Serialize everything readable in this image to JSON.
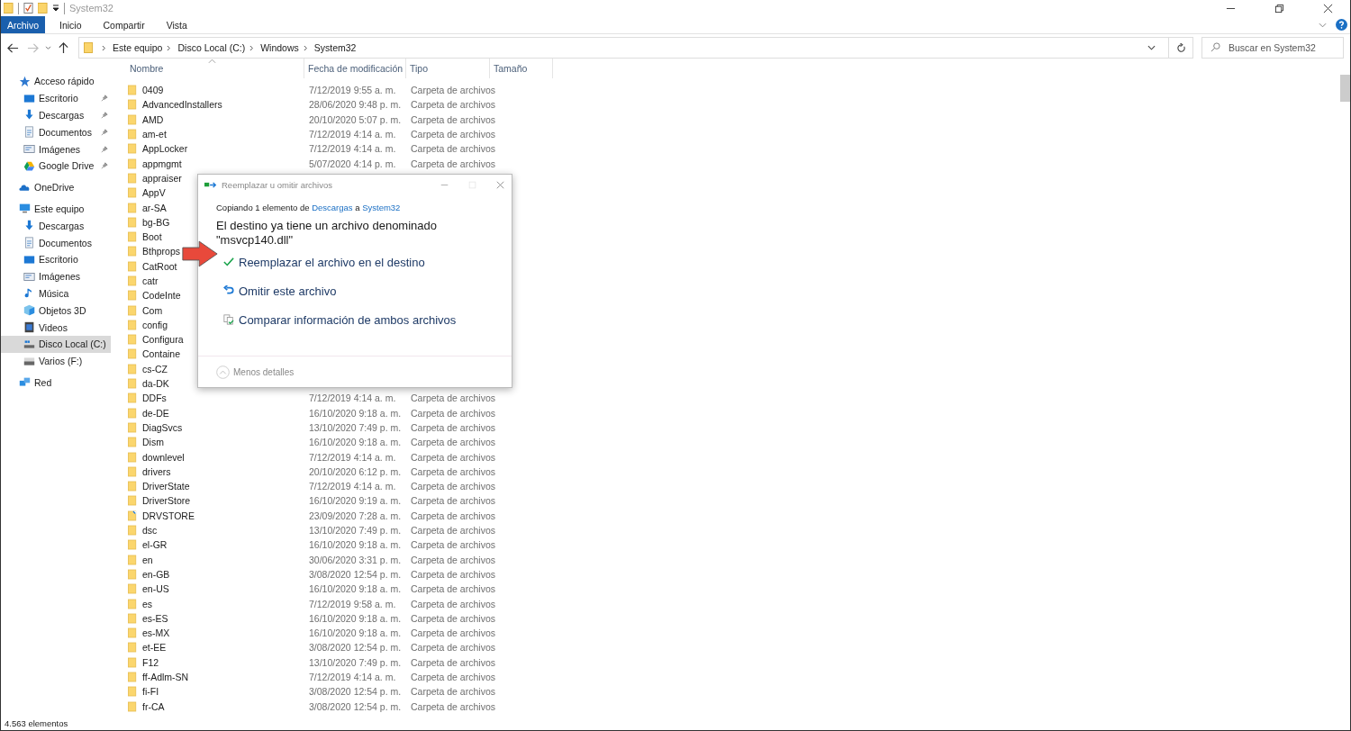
{
  "window": {
    "title": "System32"
  },
  "ribbon_tabs": [
    {
      "label": "Archivo",
      "selected": true
    },
    {
      "label": "Inicio",
      "selected": false
    },
    {
      "label": "Compartir",
      "selected": false
    },
    {
      "label": "Vista",
      "selected": false
    }
  ],
  "address": {
    "crumbs": [
      "Este equipo",
      "Disco Local (C:)",
      "Windows",
      "System32"
    ]
  },
  "search": {
    "placeholder": "Buscar en System32"
  },
  "sidebar": {
    "sections": [
      {
        "label": "Acceso rápido",
        "kind": "star",
        "selected": false,
        "children": [
          {
            "label": "Escritorio",
            "kind": "desktop",
            "pinned": true,
            "selected": false
          },
          {
            "label": "Descargas",
            "kind": "download",
            "pinned": true,
            "selected": false
          },
          {
            "label": "Documentos",
            "kind": "document",
            "pinned": true,
            "selected": false
          },
          {
            "label": "Imágenes",
            "kind": "pictures",
            "pinned": true,
            "selected": false
          },
          {
            "label": "Google Drive",
            "kind": "drive",
            "pinned": true,
            "selected": false
          }
        ]
      },
      {
        "label": "OneDrive",
        "kind": "cloud",
        "selected": false
      },
      {
        "label": "Este equipo",
        "kind": "computer",
        "selected": false,
        "children": [
          {
            "label": "Descargas",
            "kind": "download",
            "pinned": false,
            "selected": false
          },
          {
            "label": "Documentos",
            "kind": "document",
            "pinned": false,
            "selected": false
          },
          {
            "label": "Escritorio",
            "kind": "desktop",
            "pinned": false,
            "selected": false
          },
          {
            "label": "Imágenes",
            "kind": "pictures",
            "pinned": false,
            "selected": false
          },
          {
            "label": "Música",
            "kind": "music",
            "pinned": false,
            "selected": false
          },
          {
            "label": "Objetos 3D",
            "kind": "cube",
            "pinned": false,
            "selected": false
          },
          {
            "label": "Videos",
            "kind": "film",
            "pinned": false,
            "selected": false
          },
          {
            "label": "Disco Local (C:)",
            "kind": "disk",
            "pinned": false,
            "selected": true
          },
          {
            "label": "Varios (F:)",
            "kind": "removable",
            "pinned": false,
            "selected": false
          }
        ]
      },
      {
        "label": "Red",
        "kind": "network",
        "selected": false
      }
    ]
  },
  "table": {
    "columns": [
      "Nombre",
      "Fecha de modificación",
      "Tipo",
      "Tamaño"
    ],
    "rows": [
      {
        "name": "0409",
        "kind": "folder",
        "date": "7/12/2019 9:55 a. m.",
        "type": "Carpeta de archivos"
      },
      {
        "name": "AdvancedInstallers",
        "kind": "folder",
        "date": "28/06/2020 9:48 p. m.",
        "type": "Carpeta de archivos"
      },
      {
        "name": "AMD",
        "kind": "folder",
        "date": "20/10/2020 5:07 p. m.",
        "type": "Carpeta de archivos"
      },
      {
        "name": "am-et",
        "kind": "folder",
        "date": "7/12/2019 4:14 a. m.",
        "type": "Carpeta de archivos"
      },
      {
        "name": "AppLocker",
        "kind": "folder",
        "date": "7/12/2019 4:14 a. m.",
        "type": "Carpeta de archivos"
      },
      {
        "name": "appmgmt",
        "kind": "folder",
        "date": "5/07/2020 4:14 p. m.",
        "type": "Carpeta de archivos"
      },
      {
        "name": "appraiser",
        "kind": "folder"
      },
      {
        "name": "AppV",
        "kind": "folder"
      },
      {
        "name": "ar-SA",
        "kind": "folder"
      },
      {
        "name": "bg-BG",
        "kind": "folder"
      },
      {
        "name": "Boot",
        "kind": "folder"
      },
      {
        "name": "Bthprops",
        "kind": "folder"
      },
      {
        "name": "CatRoot",
        "kind": "folder"
      },
      {
        "name": "catr",
        "kind": "folder"
      },
      {
        "name": "CodeInte",
        "kind": "folder"
      },
      {
        "name": "Com",
        "kind": "folder"
      },
      {
        "name": "config",
        "kind": "folder"
      },
      {
        "name": "Configura",
        "kind": "folder"
      },
      {
        "name": "Containe",
        "kind": "folder"
      },
      {
        "name": "cs-CZ",
        "kind": "folder"
      },
      {
        "name": "da-DK",
        "kind": "folder"
      },
      {
        "name": "DDFs",
        "kind": "folder",
        "date": "7/12/2019 4:14 a. m.",
        "type": "Carpeta de archivos"
      },
      {
        "name": "de-DE",
        "kind": "folder",
        "date": "16/10/2020 9:18 a. m.",
        "type": "Carpeta de archivos"
      },
      {
        "name": "DiagSvcs",
        "kind": "folder",
        "date": "13/10/2020 7:49 p. m.",
        "type": "Carpeta de archivos"
      },
      {
        "name": "Dism",
        "kind": "folder",
        "date": "16/10/2020 9:18 a. m.",
        "type": "Carpeta de archivos"
      },
      {
        "name": "downlevel",
        "kind": "folder",
        "date": "7/12/2019 4:14 a. m.",
        "type": "Carpeta de archivos"
      },
      {
        "name": "drivers",
        "kind": "folder",
        "date": "20/10/2020 6:12 p. m.",
        "type": "Carpeta de archivos"
      },
      {
        "name": "DriverState",
        "kind": "folder",
        "date": "7/12/2019 4:14 a. m.",
        "type": "Carpeta de archivos"
      },
      {
        "name": "DriverStore",
        "kind": "folder",
        "date": "16/10/2020 9:19 a. m.",
        "type": "Carpeta de archivos"
      },
      {
        "name": "DRVSTORE",
        "kind": "link",
        "date": "23/09/2020 7:28 a. m.",
        "type": "Carpeta de archivos"
      },
      {
        "name": "dsc",
        "kind": "folder",
        "date": "13/10/2020 7:49 p. m.",
        "type": "Carpeta de archivos"
      },
      {
        "name": "el-GR",
        "kind": "folder",
        "date": "16/10/2020 9:18 a. m.",
        "type": "Carpeta de archivos"
      },
      {
        "name": "en",
        "kind": "folder",
        "date": "30/06/2020 3:31 p. m.",
        "type": "Carpeta de archivos"
      },
      {
        "name": "en-GB",
        "kind": "folder",
        "date": "3/08/2020 12:54 p. m.",
        "type": "Carpeta de archivos"
      },
      {
        "name": "en-US",
        "kind": "folder",
        "date": "16/10/2020 9:18 a. m.",
        "type": "Carpeta de archivos"
      },
      {
        "name": "es",
        "kind": "folder",
        "date": "7/12/2019 9:58 a. m.",
        "type": "Carpeta de archivos"
      },
      {
        "name": "es-ES",
        "kind": "folder",
        "date": "16/10/2020 9:18 a. m.",
        "type": "Carpeta de archivos"
      },
      {
        "name": "es-MX",
        "kind": "folder",
        "date": "16/10/2020 9:18 a. m.",
        "type": "Carpeta de archivos"
      },
      {
        "name": "et-EE",
        "kind": "folder",
        "date": "3/08/2020 12:54 p. m.",
        "type": "Carpeta de archivos"
      },
      {
        "name": "F12",
        "kind": "folder",
        "date": "13/10/2020 7:49 p. m.",
        "type": "Carpeta de archivos"
      },
      {
        "name": "ff-Adlm-SN",
        "kind": "folder",
        "date": "7/12/2019 4:14 a. m.",
        "type": "Carpeta de archivos"
      },
      {
        "name": "fi-FI",
        "kind": "folder",
        "date": "3/08/2020 12:54 p. m.",
        "type": "Carpeta de archivos"
      },
      {
        "name": "fr-CA",
        "kind": "folder",
        "date": "3/08/2020 12:54 p. m.",
        "type": "Carpeta de archivos"
      }
    ]
  },
  "dialog": {
    "title": "Reemplazar u omitir archivos",
    "copying": {
      "before": "Copiando 1 elemento de",
      "source": "Descargas",
      "middle": "a",
      "target": "System32"
    },
    "message": "El destino ya tiene un archivo denominado \"msvcp140.dll\"",
    "options": [
      {
        "kind": "replace",
        "label": "Reemplazar el archivo en el destino",
        "pointed": true
      },
      {
        "kind": "skip",
        "label": "Omitir este archivo",
        "pointed": false
      },
      {
        "kind": "compare",
        "label": "Comparar información de ambos archivos",
        "pointed": false
      }
    ],
    "details_toggle": "Menos detalles"
  },
  "status_bar": {
    "count": "4.563 elementos"
  }
}
